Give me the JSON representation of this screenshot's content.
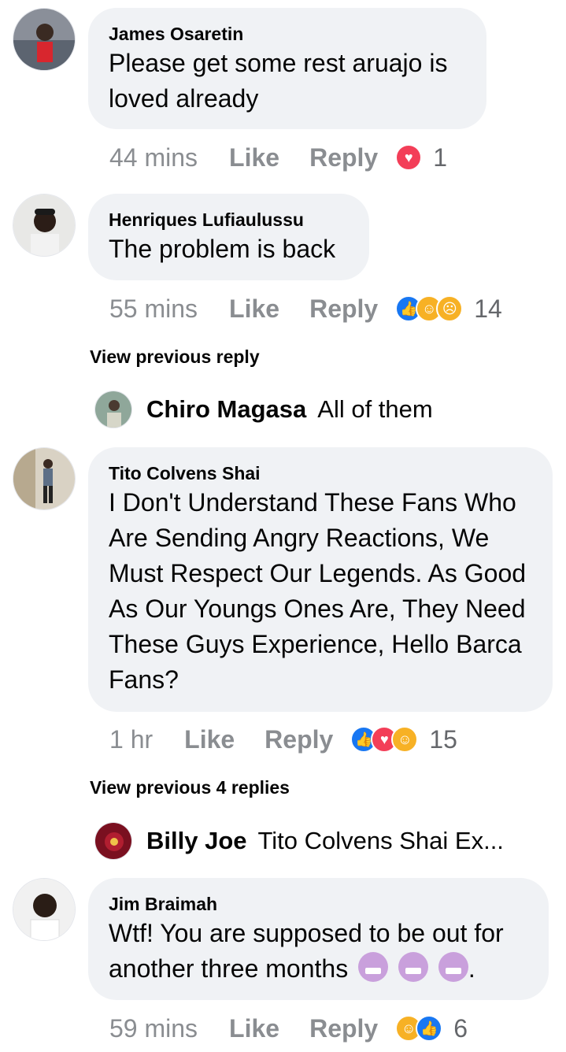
{
  "comments": [
    {
      "author": "James Osaretin",
      "text": "Please get some rest aruajo is loved already",
      "time": "44 mins",
      "like": "Like",
      "reply": "Reply",
      "reactions": [
        "love"
      ],
      "reaction_count": "1"
    },
    {
      "author": "Henriques Lufiaulussu",
      "text": "The problem is back",
      "time": "55 mins",
      "like": "Like",
      "reply": "Reply",
      "reactions": [
        "like",
        "haha",
        "sad"
      ],
      "reaction_count": "14"
    },
    {
      "author": "Tito Colvens Shai",
      "text": "I Don't Understand These Fans Who Are Sending Angry Reactions, We Must Respect Our Legends. As Good As Our Youngs Ones Are, They Need These Guys Experience, Hello Barca Fans?",
      "time": "1 hr",
      "like": "Like",
      "reply": "Reply",
      "reactions": [
        "like",
        "love",
        "haha"
      ],
      "reaction_count": "15"
    },
    {
      "author": "Jim Braimah",
      "text": "Wtf! You are supposed to be out for another three months",
      "text_suffix": ".",
      "time": "59 mins",
      "like": "Like",
      "reply": "Reply",
      "reactions": [
        "haha",
        "like"
      ],
      "reaction_count": "6"
    }
  ],
  "view_previous": [
    {
      "label": "View previous reply"
    },
    {
      "label": "View previous 4 replies"
    }
  ],
  "replies": [
    {
      "author": "Chiro Magasa",
      "text": "All of them"
    },
    {
      "author": "Billy Joe",
      "text": "Tito Colvens Shai Ex..."
    }
  ],
  "colors": {
    "bubble": "#f0f2f5",
    "meta_text": "#8a8d91",
    "like_blue": "#1877f2",
    "love_red": "#f33e58",
    "haha_yellow": "#f7b125"
  },
  "icons": {
    "love": "heart-icon",
    "like": "thumbs-up-icon",
    "haha": "laughing-face-icon",
    "sad": "sad-face-icon",
    "inline_emoji": "weary-face-emoji"
  }
}
